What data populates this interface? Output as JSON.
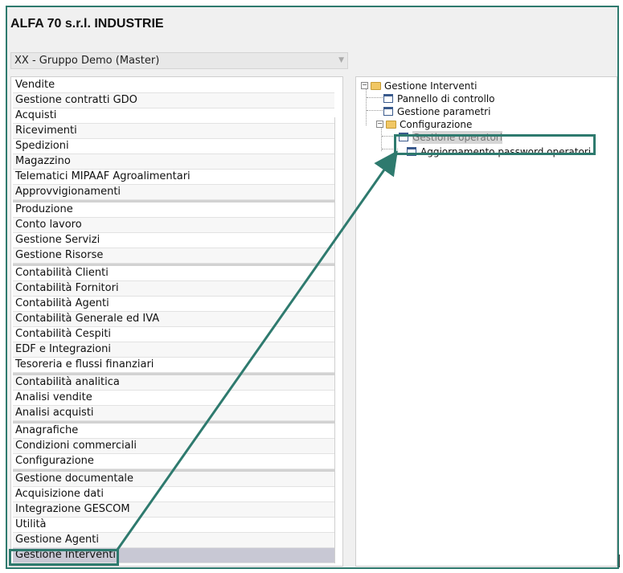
{
  "app": {
    "title": "ALFA 70 s.r.l. INDUSTRIE",
    "company_selector": "XX - Gruppo Demo (Master)"
  },
  "menu": {
    "items": [
      {
        "label": "Vendite"
      },
      {
        "label": "Gestione contratti GDO"
      },
      {
        "label": "Acquisti"
      },
      {
        "label": "Ricevimenti"
      },
      {
        "label": "Spedizioni"
      },
      {
        "label": "Magazzino"
      },
      {
        "label": "Telematici MIPAAF Agroalimentari"
      },
      {
        "label": "Approvvigionamenti"
      },
      {
        "label": "Produzione"
      },
      {
        "label": "Conto lavoro"
      },
      {
        "label": "Gestione Servizi"
      },
      {
        "label": "Gestione Risorse"
      },
      {
        "label": "Contabilità Clienti"
      },
      {
        "label": "Contabilità Fornitori"
      },
      {
        "label": "Contabilità Agenti"
      },
      {
        "label": "Contabilità Generale ed IVA"
      },
      {
        "label": "Contabilità Cespiti"
      },
      {
        "label": "EDF e Integrazioni"
      },
      {
        "label": "Tesoreria e flussi finanziari"
      },
      {
        "label": "Contabilità analitica"
      },
      {
        "label": "Analisi vendite"
      },
      {
        "label": "Analisi acquisti"
      },
      {
        "label": "Anagrafiche"
      },
      {
        "label": "Condizioni commerciali"
      },
      {
        "label": "Configurazione"
      },
      {
        "label": "Gestione documentale"
      },
      {
        "label": "Acquisizione dati"
      },
      {
        "label": "Integrazione GESCOM"
      },
      {
        "label": "Utilità"
      },
      {
        "label": "Gestione Agenti"
      },
      {
        "label": "Gestione Interventi"
      }
    ]
  },
  "tree": {
    "root": "Gestione Interventi",
    "pannello": "Pannello di controllo",
    "parametri": "Gestione parametri",
    "configurazione": "Configurazione",
    "operatori": "Gestione operatori",
    "password": "Aggiornamento password operatori"
  },
  "colors": {
    "accent": "#2e7a6e",
    "selected_row": "#c8c8d4",
    "folder": "#f1c764"
  }
}
